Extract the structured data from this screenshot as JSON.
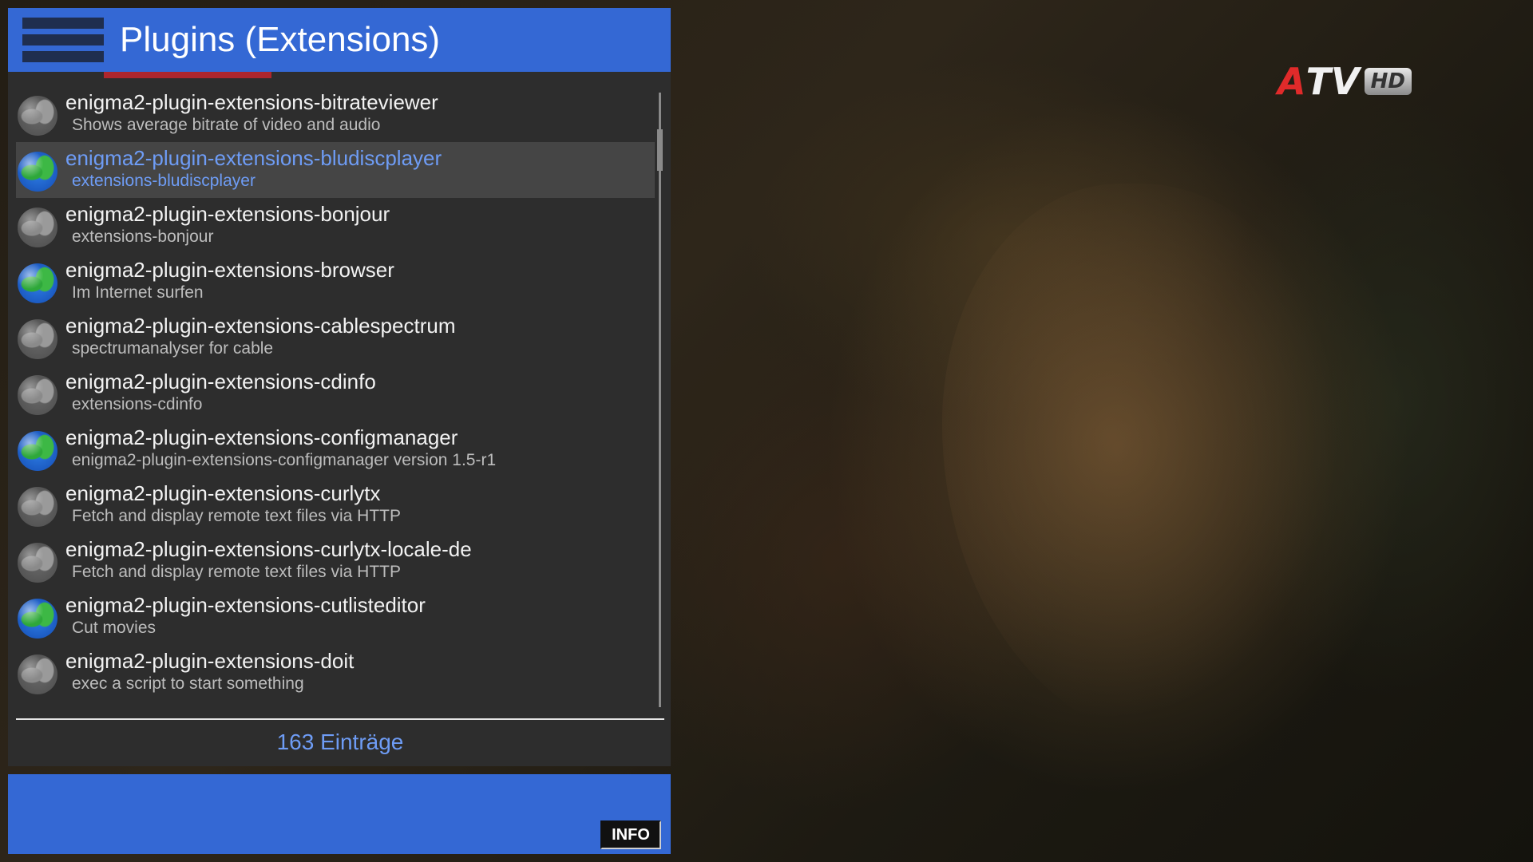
{
  "header": {
    "title": "Plugins (Extensions)"
  },
  "plugins": [
    {
      "name": "enigma2-plugin-extensions-bitrateviewer",
      "description": "Shows average bitrate of video and audio",
      "status": "inactive"
    },
    {
      "name": "enigma2-plugin-extensions-bludiscplayer",
      "description": "extensions-bludiscplayer",
      "status": "active"
    },
    {
      "name": "enigma2-plugin-extensions-bonjour",
      "description": "extensions-bonjour",
      "status": "inactive"
    },
    {
      "name": "enigma2-plugin-extensions-browser",
      "description": "Im Internet surfen",
      "status": "active"
    },
    {
      "name": "enigma2-plugin-extensions-cablespectrum",
      "description": "spectrumanalyser for cable",
      "status": "inactive"
    },
    {
      "name": "enigma2-plugin-extensions-cdinfo",
      "description": "extensions-cdinfo",
      "status": "inactive"
    },
    {
      "name": "enigma2-plugin-extensions-configmanager",
      "description": "enigma2-plugin-extensions-configmanager version 1.5-r1",
      "status": "active"
    },
    {
      "name": "enigma2-plugin-extensions-curlytx",
      "description": "Fetch and display remote text files via HTTP",
      "status": "inactive"
    },
    {
      "name": "enigma2-plugin-extensions-curlytx-locale-de",
      "description": "Fetch and display remote text files via HTTP",
      "status": "inactive"
    },
    {
      "name": "enigma2-plugin-extensions-cutlisteditor",
      "description": "Cut movies",
      "status": "active"
    },
    {
      "name": "enigma2-plugin-extensions-doit",
      "description": "exec a script to start something",
      "status": "inactive"
    }
  ],
  "selected_index": 1,
  "list_footer": {
    "count": "163 Einträge"
  },
  "footer": {
    "info_label": "INFO"
  },
  "channel_logo": {
    "brand": "TV",
    "brand_prefix": "A",
    "quality": "HD"
  },
  "colors": {
    "accent": "#3468d4",
    "selected_text": "#6e9cf5",
    "panel": "#2d2d2d"
  },
  "icons": {
    "active": "globe-icon",
    "inactive": "globe-inactive-icon",
    "menu": "menu-icon"
  }
}
